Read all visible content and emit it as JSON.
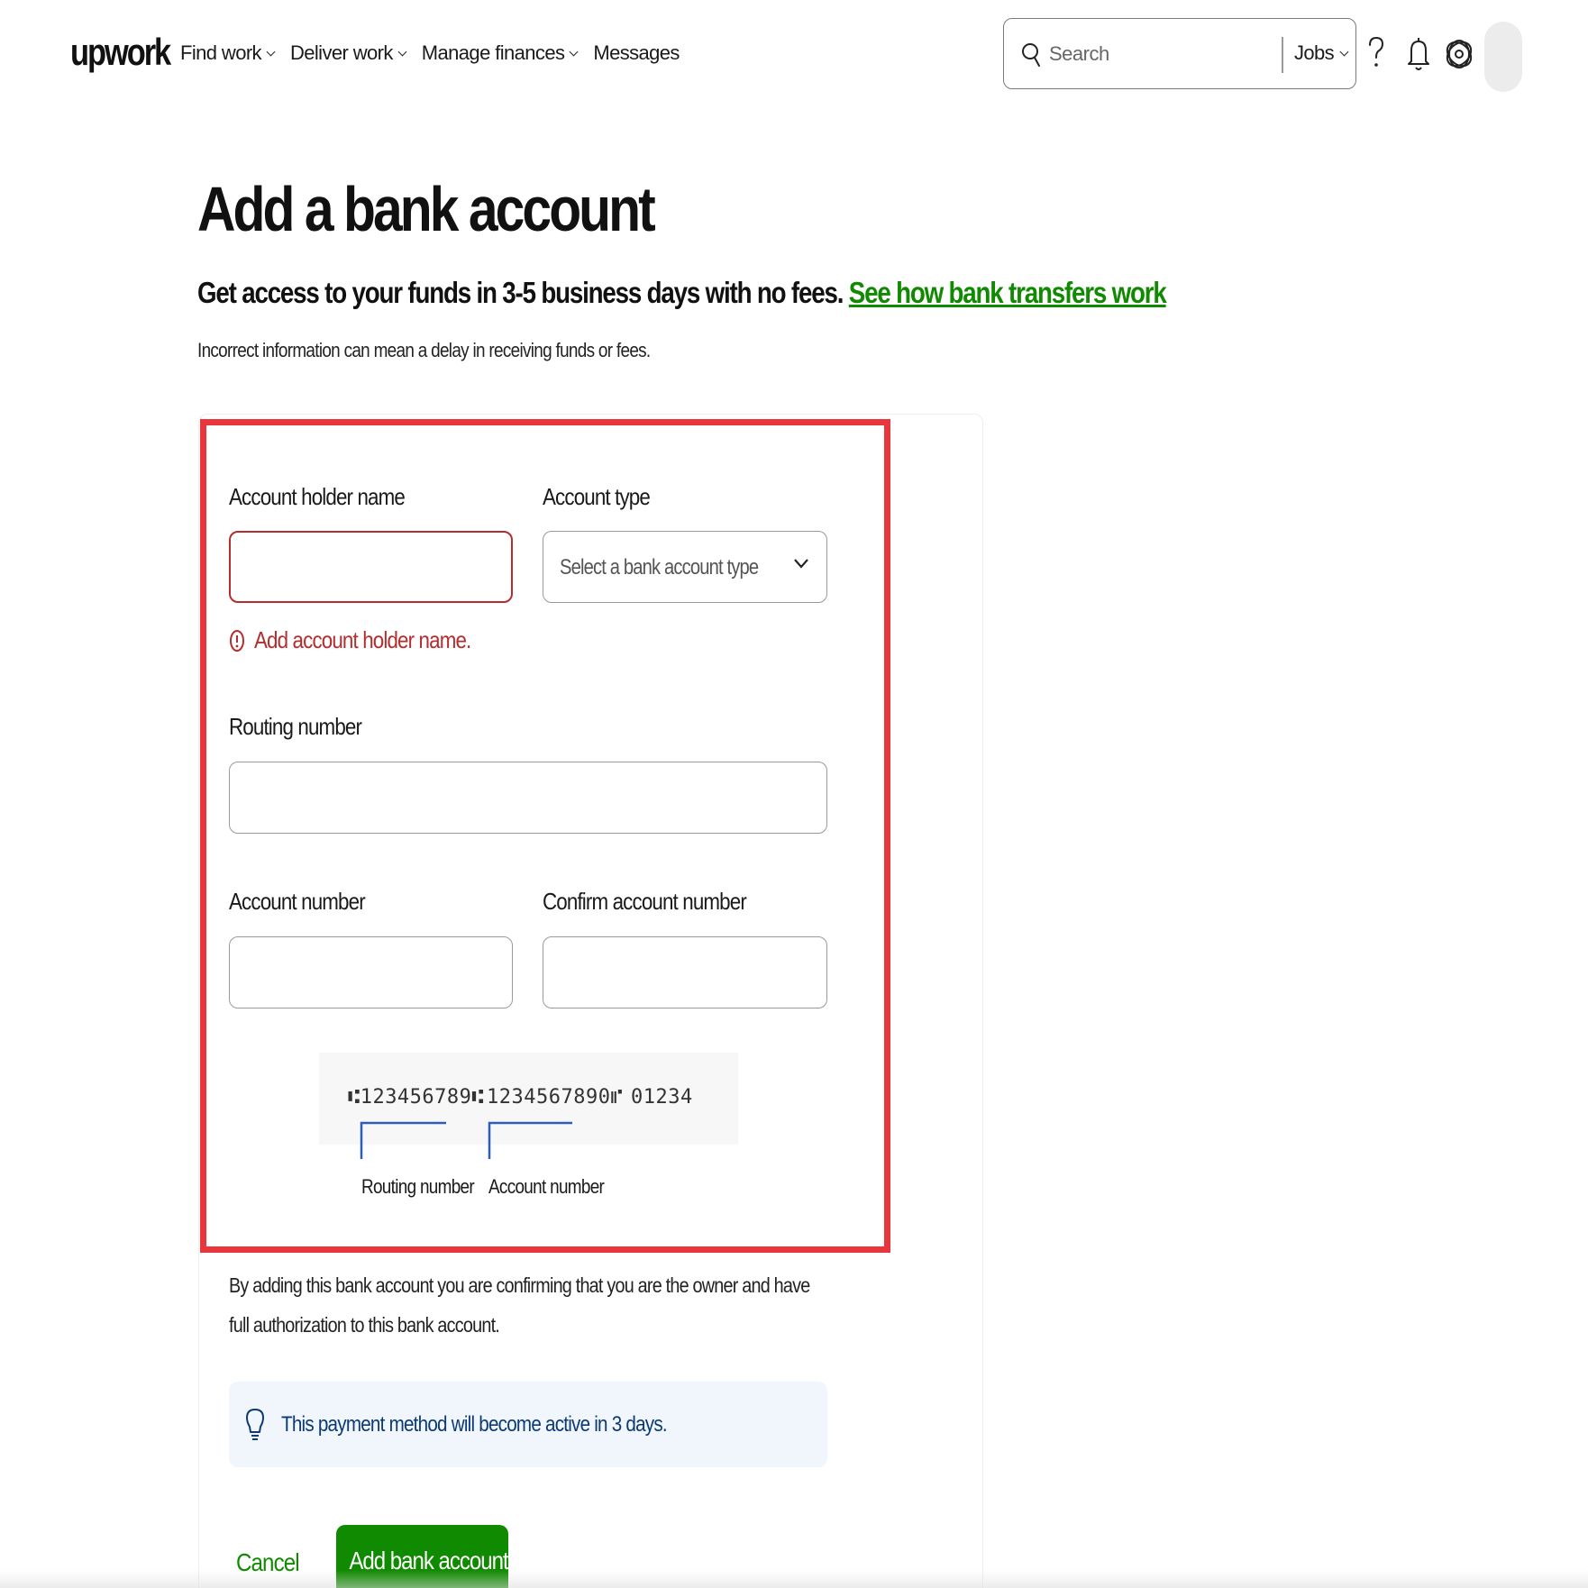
{
  "header": {
    "logo": "upwork",
    "nav": [
      {
        "label": "Find work"
      },
      {
        "label": "Deliver work"
      },
      {
        "label": "Manage finances"
      },
      {
        "label": "Messages"
      }
    ],
    "search": {
      "placeholder": "Search",
      "scope": "Jobs"
    },
    "icons": [
      "search-icon",
      "help-icon",
      "bell-icon",
      "gear-icon"
    ]
  },
  "page": {
    "title": "Add a bank account",
    "subtitle": "Get access to your funds in 3-5 business days with no fees.",
    "subtitle_link": "See how bank transfers work",
    "note": "Incorrect information can mean a delay in receiving funds or fees."
  },
  "form": {
    "holder_name": {
      "label": "Account holder name",
      "value": "",
      "error": "Add account holder name."
    },
    "account_type": {
      "label": "Account type",
      "placeholder": "Select a bank account type"
    },
    "routing": {
      "label": "Routing number",
      "value": ""
    },
    "account_number": {
      "label": "Account number",
      "value": ""
    },
    "confirm_account_number": {
      "label": "Confirm account number",
      "value": ""
    }
  },
  "check_diagram": {
    "routing_digits": "⑆123456789⑆",
    "account_digits": "1234567890⑈",
    "check_digits": "01234",
    "routing_label": "Routing number",
    "account_label": "Account number"
  },
  "consent": "By adding this bank account you are confirming that you are the owner and have full authorization to this bank account.",
  "info": "This payment method will become active in 3 days.",
  "actions": {
    "cancel": "Cancel",
    "submit": "Add bank account"
  },
  "colors": {
    "brand_green": "#108a00",
    "error_red": "#b52d2d",
    "highlight_red": "#e8363c",
    "info_bg": "#f1f6fd",
    "info_text": "#0c3a75"
  }
}
